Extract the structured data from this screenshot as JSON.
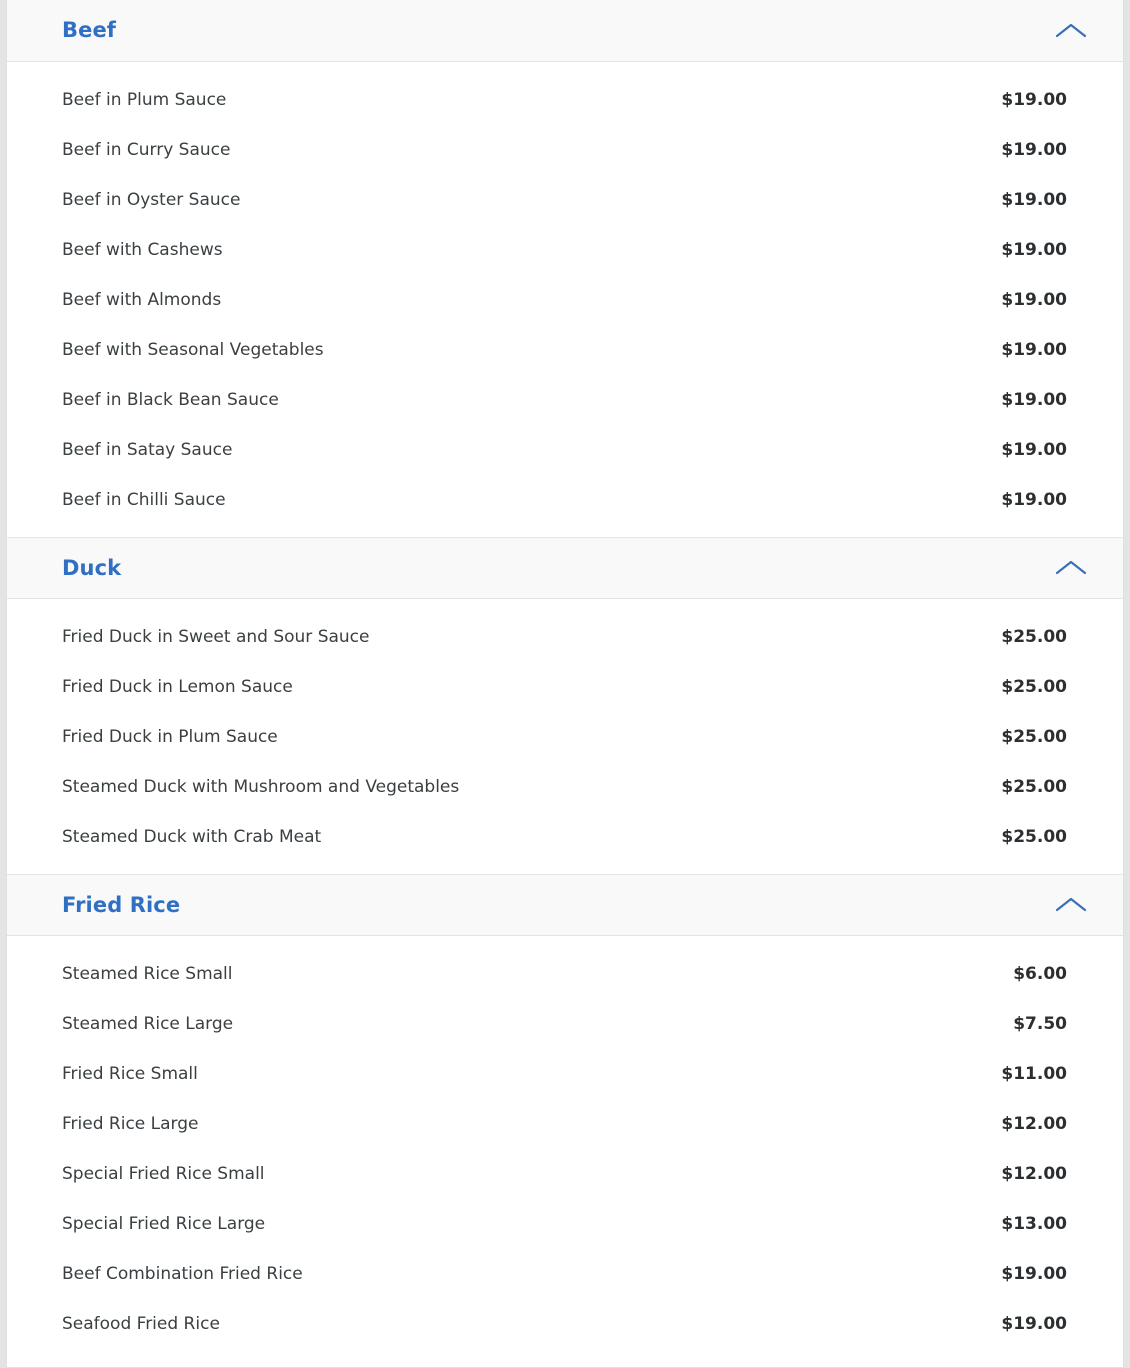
{
  "colors": {
    "section_title": "#2f6fc4",
    "chevron": "#3a6fb8",
    "item_name": "#3a3f42",
    "item_price": "#2b2f31",
    "header_background": "#f9f9f9",
    "page_background": "#e4e4e4",
    "card_background": "#ffffff"
  },
  "menu": {
    "sections": [
      {
        "title": "Beef",
        "toggle_icon": "chevron-up-icon",
        "expanded": true,
        "items": [
          {
            "name": "Beef in Plum Sauce",
            "price": "$19.00"
          },
          {
            "name": "Beef in Curry Sauce",
            "price": "$19.00"
          },
          {
            "name": "Beef in Oyster Sauce",
            "price": "$19.00"
          },
          {
            "name": "Beef with Cashews",
            "price": "$19.00"
          },
          {
            "name": "Beef with Almonds",
            "price": "$19.00"
          },
          {
            "name": "Beef with Seasonal Vegetables",
            "price": "$19.00"
          },
          {
            "name": "Beef in Black Bean Sauce",
            "price": "$19.00"
          },
          {
            "name": "Beef in Satay Sauce",
            "price": "$19.00"
          },
          {
            "name": "Beef in Chilli Sauce",
            "price": "$19.00"
          }
        ]
      },
      {
        "title": "Duck",
        "toggle_icon": "chevron-up-icon",
        "expanded": true,
        "items": [
          {
            "name": "Fried Duck in Sweet and Sour Sauce",
            "price": "$25.00"
          },
          {
            "name": "Fried Duck in Lemon Sauce",
            "price": "$25.00"
          },
          {
            "name": "Fried Duck in Plum Sauce",
            "price": "$25.00"
          },
          {
            "name": "Steamed Duck with Mushroom and Vegetables",
            "price": "$25.00"
          },
          {
            "name": "Steamed Duck with Crab Meat",
            "price": "$25.00"
          }
        ]
      },
      {
        "title": "Fried Rice",
        "toggle_icon": "chevron-up-icon",
        "expanded": true,
        "items": [
          {
            "name": "Steamed Rice Small",
            "price": "$6.00"
          },
          {
            "name": "Steamed Rice Large",
            "price": "$7.50"
          },
          {
            "name": "Fried Rice Small",
            "price": "$11.00"
          },
          {
            "name": "Fried Rice Large",
            "price": "$12.00"
          },
          {
            "name": "Special Fried Rice Small",
            "price": "$12.00"
          },
          {
            "name": "Special Fried Rice Large",
            "price": "$13.00"
          },
          {
            "name": "Beef Combination Fried Rice",
            "price": "$19.00"
          },
          {
            "name": "Seafood Fried Rice",
            "price": "$19.00"
          }
        ]
      }
    ]
  }
}
